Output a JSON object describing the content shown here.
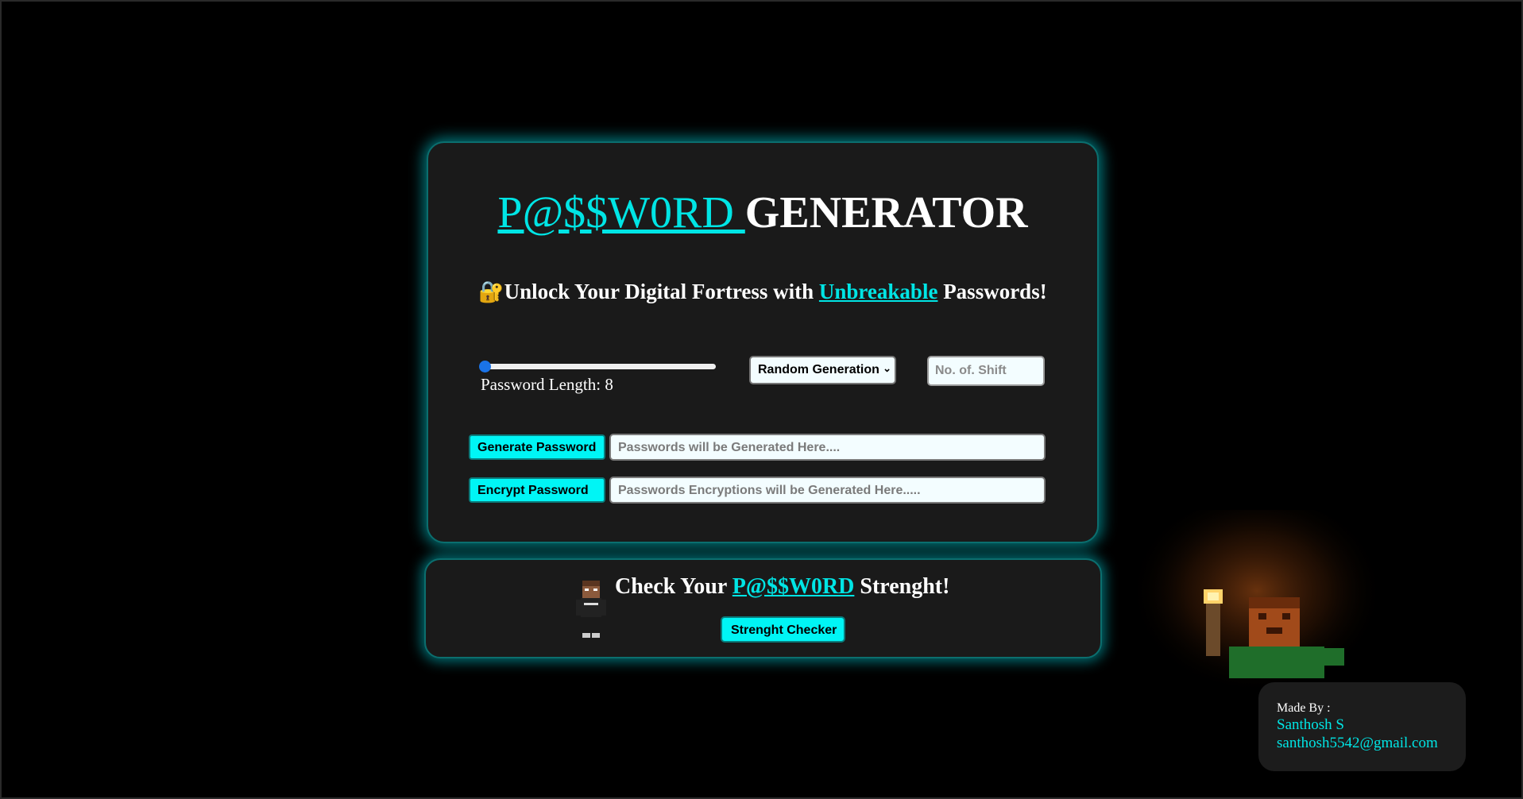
{
  "header": {
    "title_accent": "P@$$W0RD ",
    "title_rest": "GENERATOR",
    "subtitle_icon": "🔐",
    "subtitle_pre": "Unlock Your Digital Fortress with ",
    "subtitle_accent": "Unbreakable",
    "subtitle_post": " Passwords!"
  },
  "controls": {
    "length_slider_value": 8,
    "length_label": "Password Length: 8",
    "method_select": "Random Generation",
    "shift_placeholder": "No. of. Shift"
  },
  "actions": {
    "generate_label": "Generate Password",
    "generate_placeholder": "Passwords will be Generated Here....",
    "encrypt_label": "Encrypt Password",
    "encrypt_placeholder": "Passwords Encryptions will be Generated Here....."
  },
  "strength": {
    "title_pre": "Check Your ",
    "title_accent": "P@$$W0RD",
    "title_post": " Strenght!",
    "button_label": "Strenght Checker"
  },
  "credit": {
    "made_by": "Made By :",
    "name": "Santhosh S",
    "email": "santhosh5542@gmail.com"
  },
  "colors": {
    "accent": "#00e5e5",
    "card_bg": "#1a1a1a",
    "page_bg": "#000000"
  }
}
